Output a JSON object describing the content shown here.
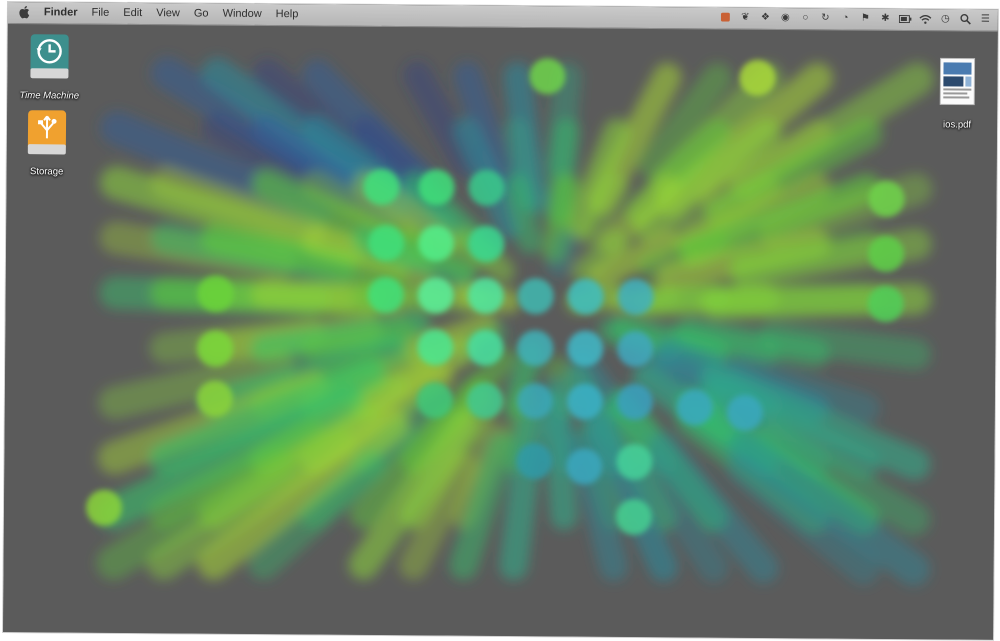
{
  "menubar": {
    "apple_icon": "apple-icon",
    "app_name": "Finder",
    "items": [
      "File",
      "Edit",
      "View",
      "Go",
      "Window",
      "Help"
    ],
    "tray_icons": [
      "notification-dot-icon",
      "evernote-icon",
      "dropbox-icon",
      "record-icon",
      "circle-icon",
      "sync-icon",
      "pie-icon",
      "flag-icon",
      "bluetooth-icon",
      "battery-icon",
      "wifi-icon",
      "clock-icon",
      "spotlight-icon",
      "list-icon"
    ],
    "accent": "#e8632b"
  },
  "desktop": {
    "icons": [
      {
        "name": "time-machine-drive",
        "label": "Time Machine",
        "color": "#3c8a8a"
      },
      {
        "name": "storage-drive",
        "label": "Storage",
        "color": "#f0a030"
      },
      {
        "name": "ios-pdf-file",
        "label": "ios.pdf"
      }
    ]
  }
}
